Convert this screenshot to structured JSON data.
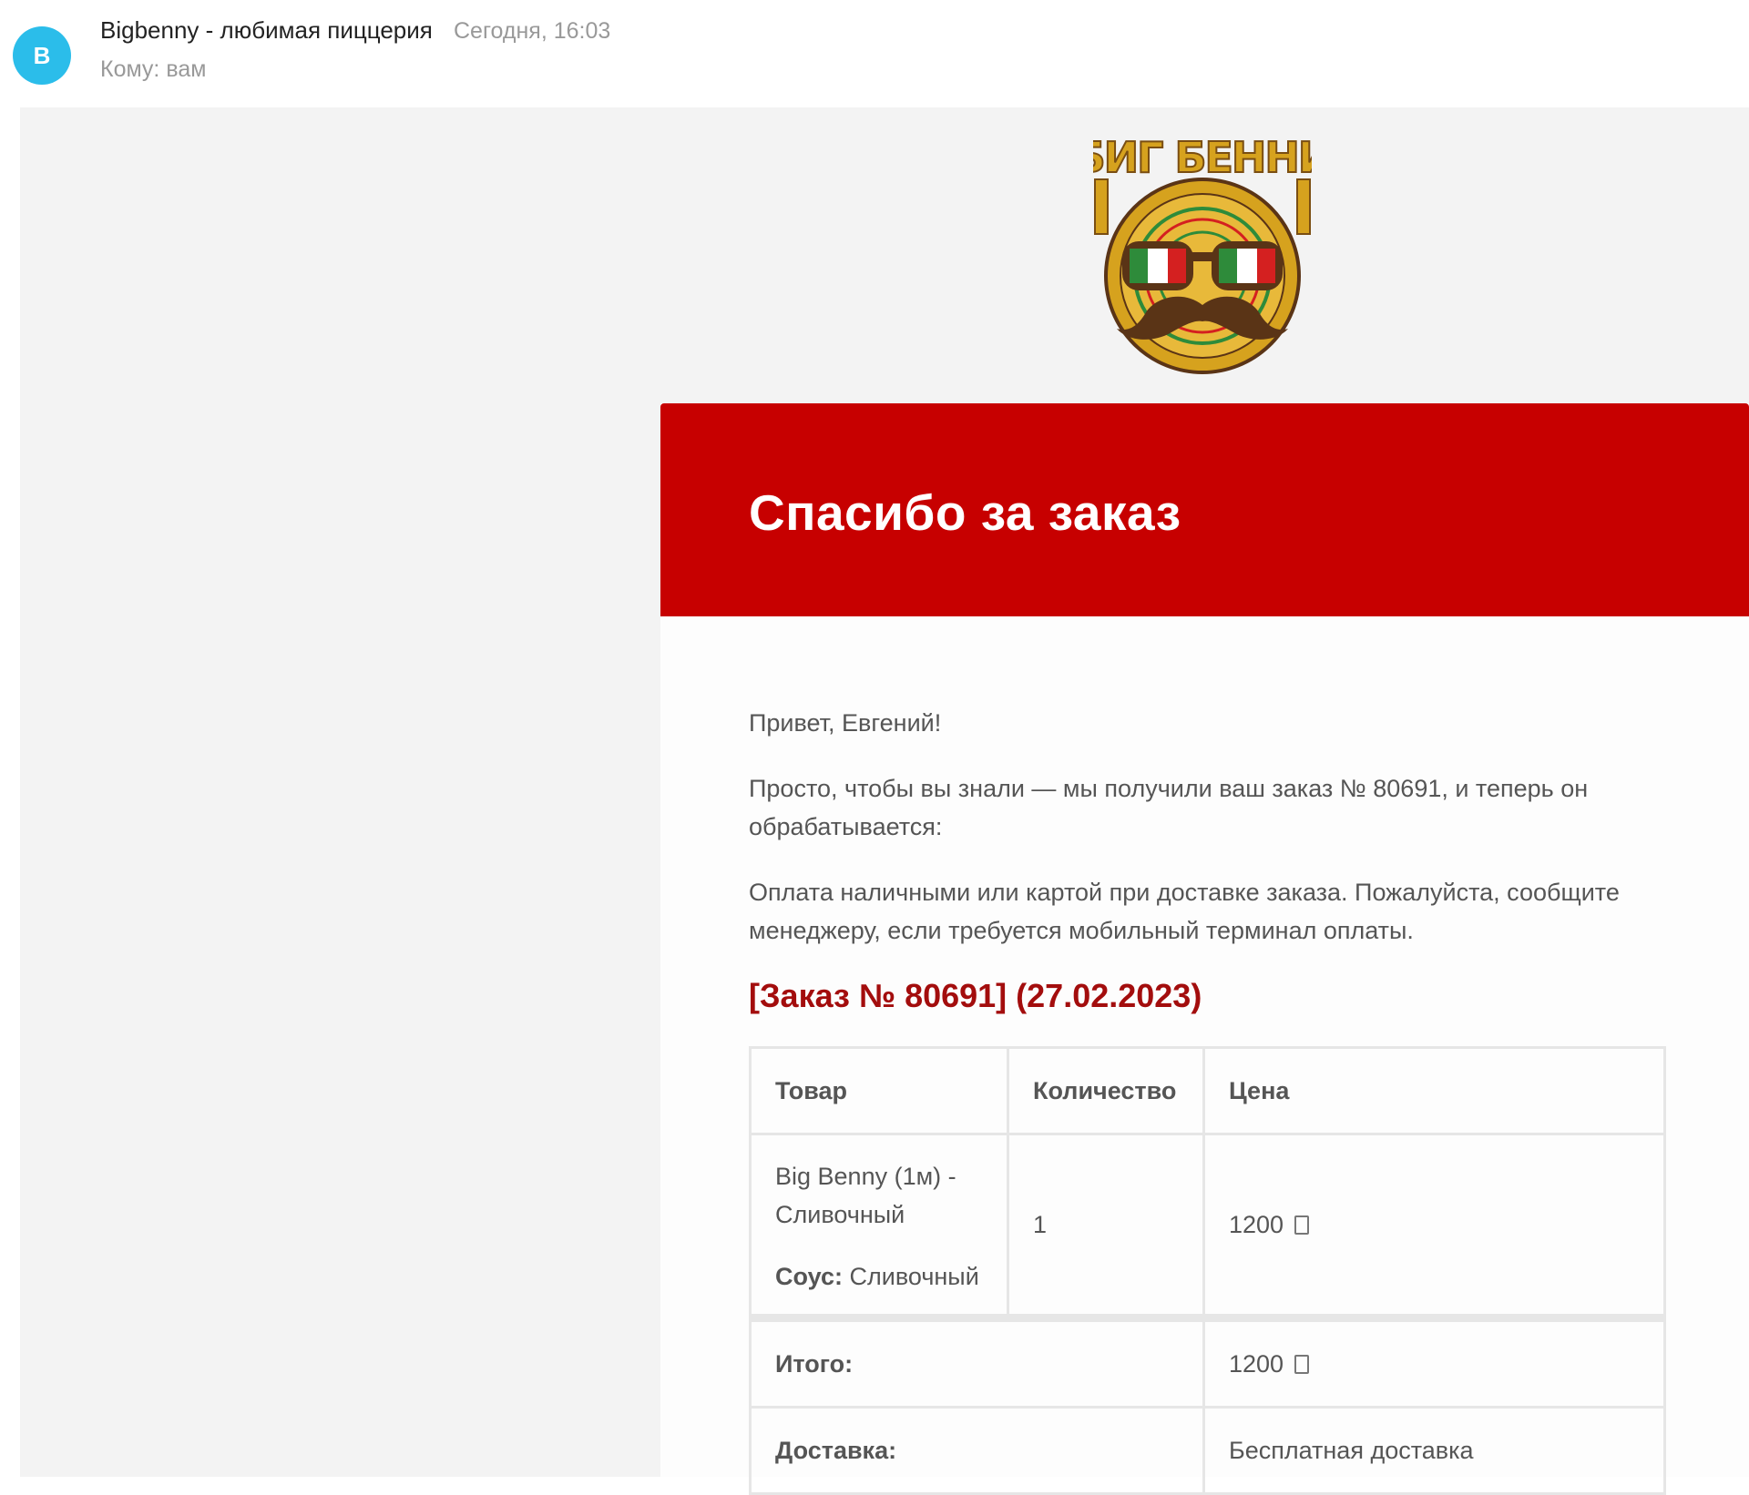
{
  "header": {
    "avatar_letter": "B",
    "sender": "Bigbenny - любимая пиццерия",
    "datetime": "Сегодня, 16:03",
    "to": "Кому: вам"
  },
  "logo": {
    "text": "БИГ БЕННИ",
    "colors": {
      "gold": "#d6a21e",
      "brown": "#5a3416",
      "red": "#d42020",
      "green": "#2e8b3a"
    }
  },
  "email": {
    "title": "Спасибо за заказ",
    "greeting": "Привет, Евгений!",
    "paragraph1": "Просто, чтобы вы знали — мы получили ваш заказ № 80691, и теперь он обрабатывается:",
    "paragraph2": "Оплата наличными или картой при доставке заказа. Пожалуйста, сообщите менеджеру, если требуется мобильный терминал оплаты.",
    "order_heading": "[Заказ № 80691] (27.02.2023)",
    "accent_color": "#c70000",
    "table": {
      "headers": {
        "product": "Товар",
        "quantity": "Количество",
        "price": "Цена"
      },
      "item": {
        "name": "Big Benny (1м) - Сливочный",
        "option_label": "Соус:",
        "option_value": "Сливочный",
        "quantity": "1",
        "price": "1200"
      },
      "total_label": "Итого:",
      "total_value": "1200",
      "delivery_label": "Доставка:",
      "delivery_value": "Бесплатная доставка"
    }
  }
}
